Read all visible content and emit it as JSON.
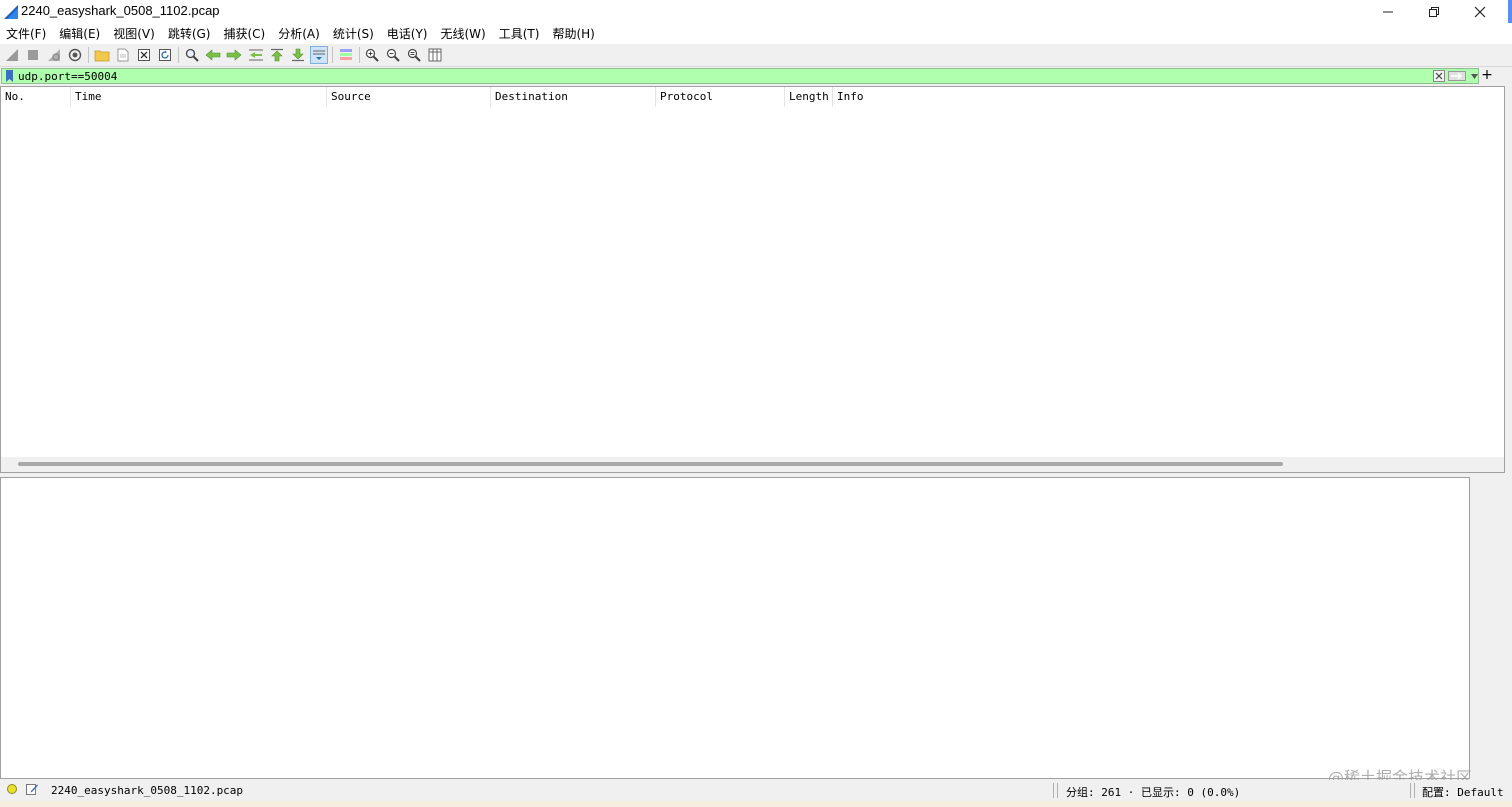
{
  "window": {
    "title": "2240_easyshark_0508_1102.pcap",
    "controls": {
      "minimize": "—",
      "maximize": "❐",
      "close": "✕"
    }
  },
  "menu": {
    "items": [
      "文件(F)",
      "编辑(E)",
      "视图(V)",
      "跳转(G)",
      "捕获(C)",
      "分析(A)",
      "统计(S)",
      "电话(Y)",
      "无线(W)",
      "工具(T)",
      "帮助(H)"
    ]
  },
  "toolbar": {
    "icons": [
      "shark-start-icon",
      "stop-icon",
      "restart-icon",
      "capture-options-icon",
      "open-folder-icon",
      "file-icon",
      "close-file-icon",
      "reload-icon",
      "find-icon",
      "back-arrow-icon",
      "forward-arrow-icon",
      "go-to-packet-icon",
      "first-packet-icon",
      "last-packet-icon",
      "autoscroll-icon",
      "colorize-icon",
      "zoom-in-icon",
      "zoom-out-icon",
      "zoom-normal-icon",
      "resize-columns-icon"
    ]
  },
  "filter": {
    "value": "udp.port==50004",
    "add_label": "+",
    "bg_color": "#afffaf"
  },
  "packet_list": {
    "columns": [
      "No.",
      "Time",
      "Source",
      "Destination",
      "Protocol",
      "Length",
      "Info"
    ],
    "rows": []
  },
  "status": {
    "file": "2240_easyshark_0508_1102.pcap",
    "packets": "分组: 261 · 已显示: 0 (0.0%)",
    "profile": "配置: Default"
  },
  "watermark": "@稀土掘金技术社区"
}
